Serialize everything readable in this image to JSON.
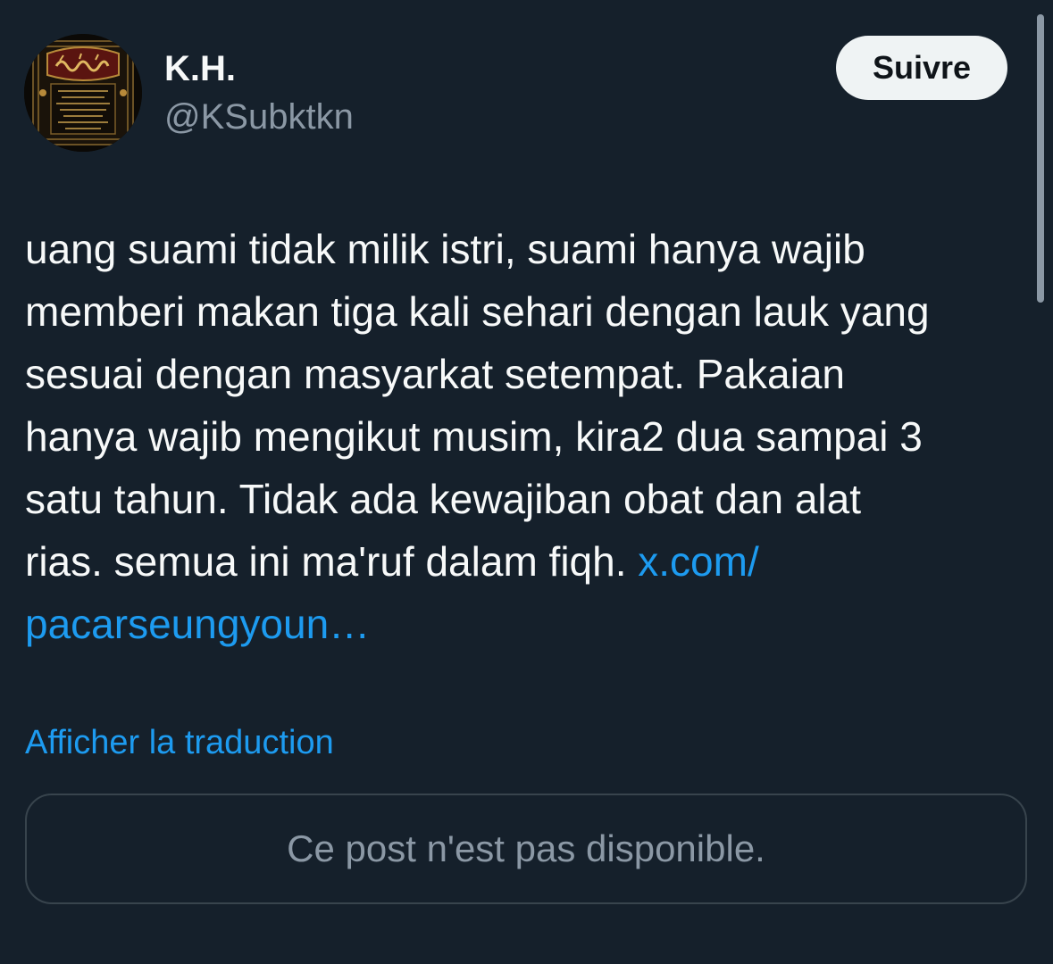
{
  "post": {
    "author": {
      "display_name": "K.H.",
      "handle": "@KSubktkn"
    },
    "follow_button_label": "Suivre",
    "text_lines": [
      "uang suami tidak milik istri, suami hanya wajib",
      "memberi makan tiga kali sehari dengan lauk yang",
      "sesuai dengan masyarkat setempat. Pakaian",
      "hanya wajib mengikut musim, kira2 dua sampai 3",
      "satu tahun. Tidak ada kewajiban obat dan alat",
      "rias. semua ini ma'ruf dalam fiqh. "
    ],
    "link_part1": "x.com/",
    "link_part2": "pacarseungyoun…",
    "translate_label": "Afficher la traduction",
    "quoted_unavailable": "Ce post n'est pas disponible."
  },
  "colors": {
    "background": "#15202b",
    "text_primary": "#f7f9f9",
    "text_secondary": "#8b98a5",
    "link": "#1d9bf0",
    "button_bg": "#eff3f4",
    "border": "#38444d"
  },
  "icons": {
    "avatar": "calligraphy-book-cover-avatar"
  }
}
